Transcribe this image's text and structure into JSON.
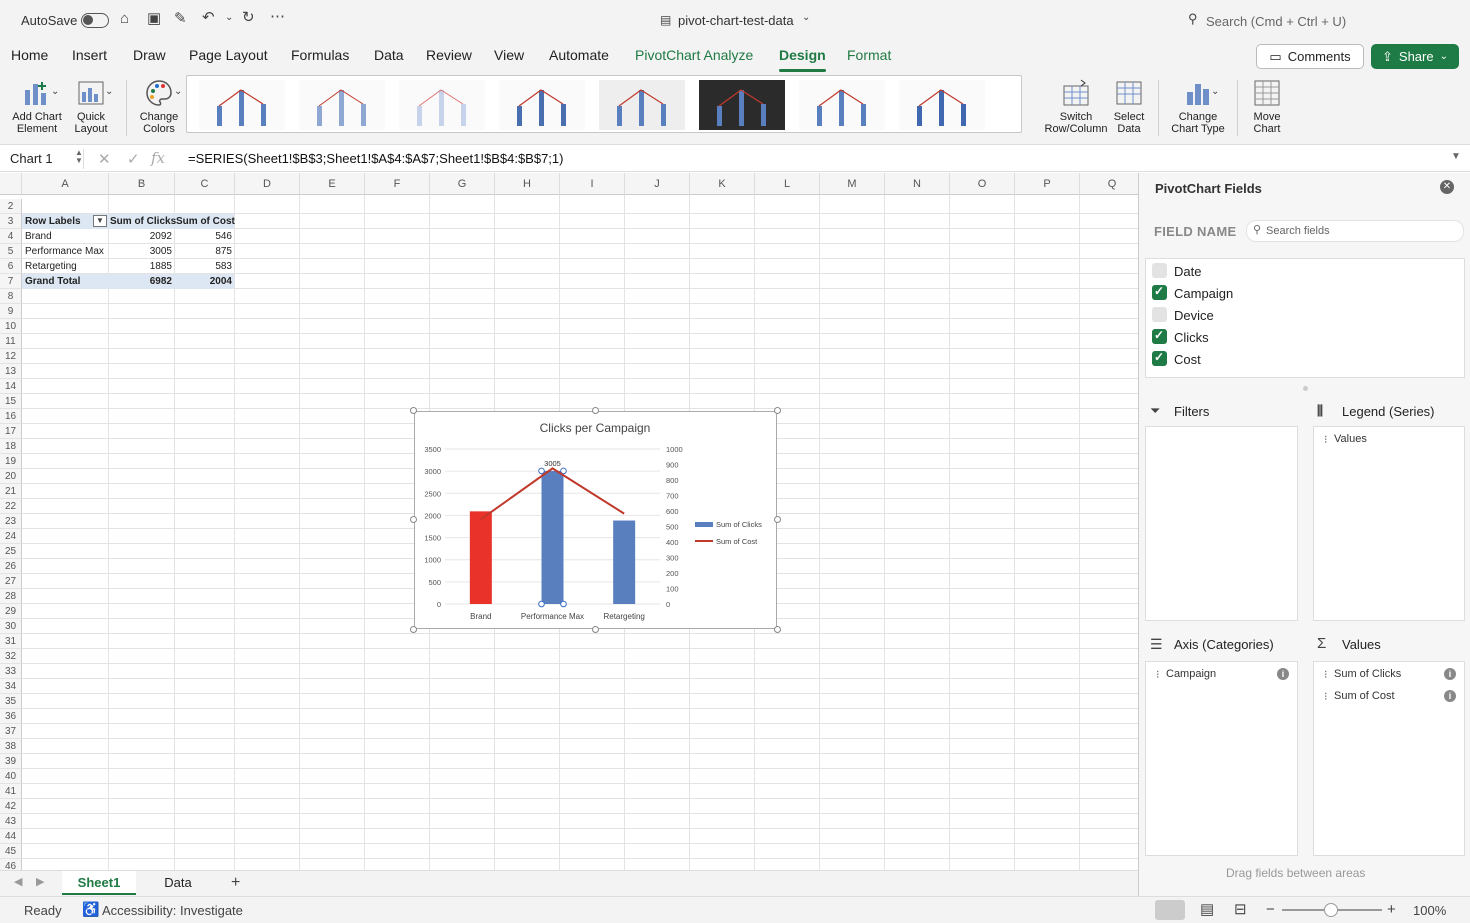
{
  "titlebar": {
    "autosave": "AutoSave",
    "doc_title": "pivot-chart-test-data",
    "search": "Search (Cmd + Ctrl + U)"
  },
  "tabs": [
    "Home",
    "Insert",
    "Draw",
    "Page Layout",
    "Formulas",
    "Data",
    "Review",
    "View",
    "Automate",
    "PivotChart Analyze",
    "Design",
    "Format"
  ],
  "actions": {
    "comments": "Comments",
    "share": "Share"
  },
  "ribbon": {
    "add_chart_element": [
      "Add Chart",
      "Element"
    ],
    "quick_layout": [
      "Quick",
      "Layout"
    ],
    "change_colors": [
      "Change",
      "Colors"
    ],
    "switch_row_column": [
      "Switch",
      "Row/Column"
    ],
    "select_data": [
      "Select",
      "Data"
    ],
    "change_chart_type": [
      "Change",
      "Chart Type"
    ],
    "move_chart": [
      "Move",
      "Chart"
    ]
  },
  "formula_bar": {
    "name_box": "Chart 1",
    "formula": "=SERIES(Sheet1!$B$3;Sheet1!$A$4:$A$7;Sheet1!$B$4:$B$7;1)"
  },
  "sheet": {
    "columns": [
      "A",
      "B",
      "C",
      "D",
      "E",
      "F",
      "G",
      "H",
      "I",
      "J",
      "K",
      "L",
      "M",
      "N",
      "O",
      "P",
      "Q"
    ],
    "rows": [
      "2",
      "3",
      "4",
      "5",
      "6",
      "7",
      "8",
      "9",
      "10",
      "11",
      "12",
      "13",
      "14",
      "15",
      "16",
      "17",
      "18",
      "19",
      "20",
      "21",
      "22",
      "23",
      "24",
      "25",
      "26",
      "27",
      "28",
      "29",
      "30",
      "31",
      "32",
      "33",
      "34",
      "35",
      "36",
      "37",
      "38",
      "39",
      "40",
      "41",
      "42",
      "43",
      "44",
      "45",
      "46"
    ],
    "pivot": {
      "headers": [
        "Row Labels",
        "Sum of Clicks",
        "Sum of Cost"
      ],
      "rows": [
        [
          "Brand",
          "2092",
          "546"
        ],
        [
          "Performance Max",
          "3005",
          "875"
        ],
        [
          "Retargeting",
          "1885",
          "583"
        ]
      ],
      "total": [
        "Grand Total",
        "6982",
        "2004"
      ]
    }
  },
  "chart_data": {
    "type": "bar",
    "title": "Clicks per Campaign",
    "categories": [
      "Brand",
      "Performance Max",
      "Retargeting"
    ],
    "series": [
      {
        "name": "Sum of Clicks",
        "type": "bar",
        "axis": "left",
        "values": [
          2092,
          3005,
          1885
        ],
        "color": "#5a7fbf",
        "highlight_color": "#e8322a"
      },
      {
        "name": "Sum of Cost",
        "type": "line",
        "axis": "right",
        "values": [
          546,
          875,
          583
        ],
        "color": "#c0392b"
      }
    ],
    "y_left": {
      "min": 0,
      "max": 3500,
      "ticks": [
        "0",
        "500",
        "1000",
        "1500",
        "2000",
        "2500",
        "3000",
        "3500"
      ]
    },
    "y_right": {
      "min": 0,
      "max": 1000,
      "ticks": [
        "0",
        "100",
        "200",
        "300",
        "400",
        "500",
        "600",
        "700",
        "800",
        "900",
        "1000"
      ]
    },
    "data_label": "3005",
    "legend": "right",
    "grid": true
  },
  "sheet_tabs": [
    "Sheet1",
    "Data"
  ],
  "status": {
    "ready": "Ready",
    "accessibility": "Accessibility: Investigate",
    "zoom": "100%"
  },
  "pane": {
    "title": "PivotChart Fields",
    "field_name": "FIELD NAME",
    "search_placeholder": "Search fields",
    "fields": [
      {
        "label": "Date",
        "checked": false
      },
      {
        "label": "Campaign",
        "checked": true
      },
      {
        "label": "Device",
        "checked": false
      },
      {
        "label": "Clicks",
        "checked": true
      },
      {
        "label": "Cost",
        "checked": true
      }
    ],
    "filters": "Filters",
    "legend_series": "Legend (Series)",
    "legend_items": [
      "Values"
    ],
    "axis_categories": "Axis (Categories)",
    "axis_items": [
      "Campaign"
    ],
    "values": "Values",
    "values_items": [
      "Sum of Clicks",
      "Sum of Cost"
    ],
    "drag_hint": "Drag fields between areas"
  }
}
